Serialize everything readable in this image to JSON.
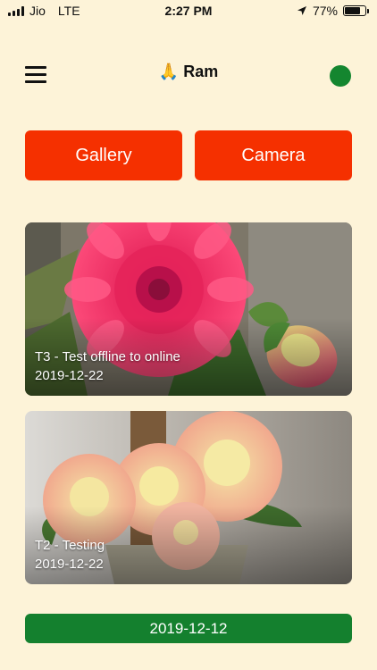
{
  "status_bar": {
    "carrier": "Jio",
    "network": "LTE",
    "time": "2:27 PM",
    "battery_percent": "77%",
    "battery_level": 0.77
  },
  "header": {
    "title": "🙏 Ram",
    "status_color": "#14862f"
  },
  "buttons": {
    "gallery": "Gallery",
    "camera": "Camera",
    "color": "#f53000"
  },
  "entries": [
    {
      "title": "T3 - Test offline to online",
      "date": "2019-12-22"
    },
    {
      "title": "T2 - Testing",
      "date": "2019-12-22"
    }
  ],
  "date_divider": {
    "label": "2019-12-12",
    "color": "#14802e"
  },
  "icons": {
    "menu": "hamburger-menu-icon",
    "location": "location-arrow-icon",
    "battery": "battery-icon",
    "signal": "signal-icon"
  }
}
